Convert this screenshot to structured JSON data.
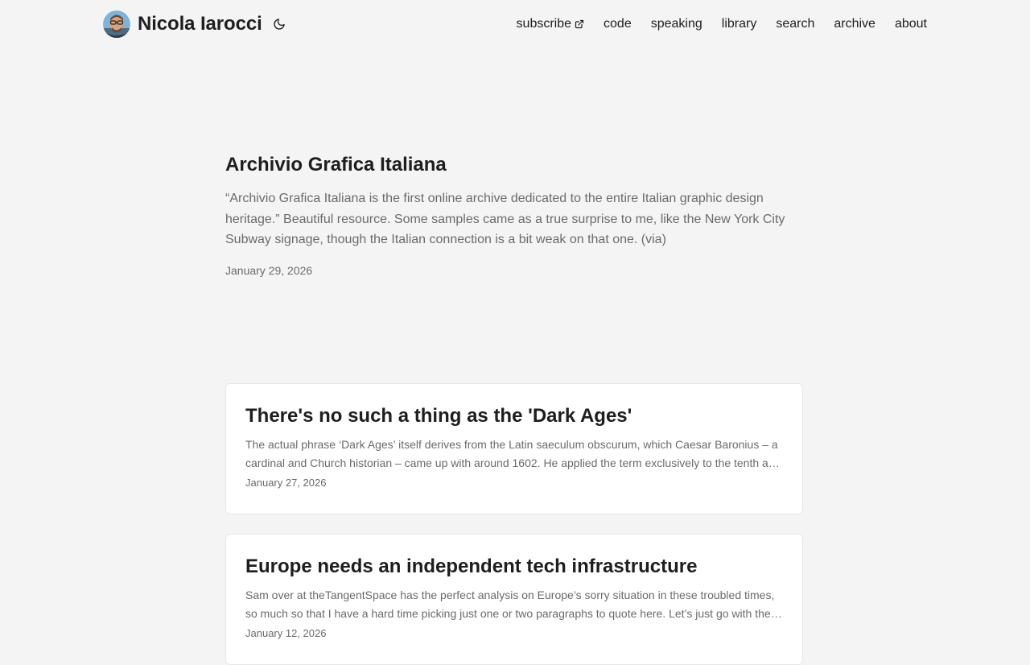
{
  "header": {
    "site_title": "Nicola Iarocci",
    "nav": [
      {
        "label": "subscribe"
      },
      {
        "label": "code"
      },
      {
        "label": "speaking"
      },
      {
        "label": "library"
      },
      {
        "label": "search"
      },
      {
        "label": "archive"
      },
      {
        "label": "about"
      }
    ]
  },
  "featured": {
    "title": "Archivio Grafica Italiana",
    "body": "“Archivio Grafica Italiana is the first online archive dedicated to the entire Italian graphic design heritage.” Beautiful resource. Some samples came as a true surprise to me, like the New York City Subway signage, though the Italian connection is a bit weak on that one. (via)",
    "date": "January 29, 2026"
  },
  "posts": [
    {
      "title": "There's no such a thing as the 'Dark Ages'",
      "excerpt": "The actual phrase ‘Dark Ages’ itself derives from the Latin saeculum obscurum, which Caesar Baronius – a cardinal and Church historian – came up with around 1602. He applied the term exclusively to the tenth and eleventh centuries, which he saw as a period of decline.",
      "date": "January 27, 2026"
    },
    {
      "title": "Europe needs an independent tech infrastructure",
      "excerpt": "Sam over at theTangentSpace has the perfect analysis on Europe’s sorry situation in these troubled times, so much so that I have a hard time picking just one or two paragraphs to quote here. Let’s just go with the opening.",
      "date": "January 12, 2026"
    }
  ],
  "colors": {
    "background": "#f4f4f4",
    "text": "#1e1e1e",
    "muted": "#6b6b6b",
    "card": "#ffffff"
  },
  "icons": {
    "theme_toggle": "moon-icon",
    "external": "external-link-icon"
  }
}
